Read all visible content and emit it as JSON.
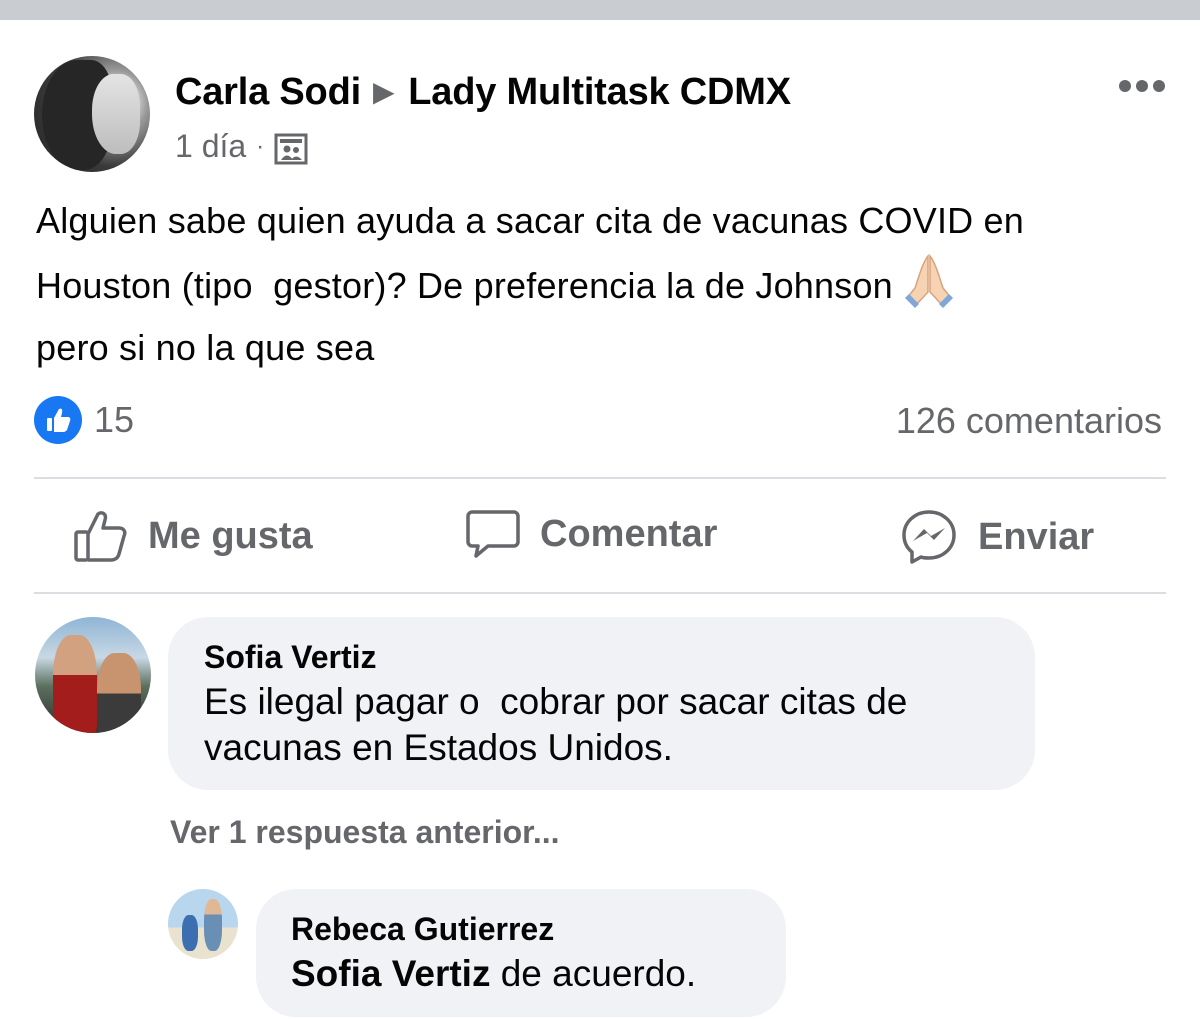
{
  "post": {
    "author": "Carla Sodi",
    "group": "Lady Multitask CDMX",
    "time": "1 día",
    "dot": "·",
    "text": "Alguien sabe quien ayuda a sacar cita de vacunas COVID en\nHouston (tipo  gestor)? De preferencia la de Johnson",
    "text_after_emoji": "\npero si no la que sea",
    "emoji": "folded-hands-emoji",
    "icons": {
      "privacy": "group-icon",
      "more": "more-dots-icon",
      "arrow": "right-triangle-icon"
    }
  },
  "stats": {
    "likes": "15",
    "comments": "126 comentarios"
  },
  "actions": {
    "like": "Me gusta",
    "comment": "Comentar",
    "send": "Enviar"
  },
  "comments": [
    {
      "author": "Sofia Vertiz",
      "text": "Es ilegal pagar o  cobrar por sacar citas de\nvacunas en Estados Unidos."
    }
  ],
  "view_replies": "Ver 1 respuesta anterior...",
  "reply": {
    "author": "Rebeca Gutierrez",
    "mention": "Sofia Vertiz",
    "text": " de acuerdo."
  },
  "colors": {
    "accent": "#1877f2",
    "secondary_text": "#65676b",
    "bubble": "#f0f2f5",
    "divider": "#dadde1"
  }
}
